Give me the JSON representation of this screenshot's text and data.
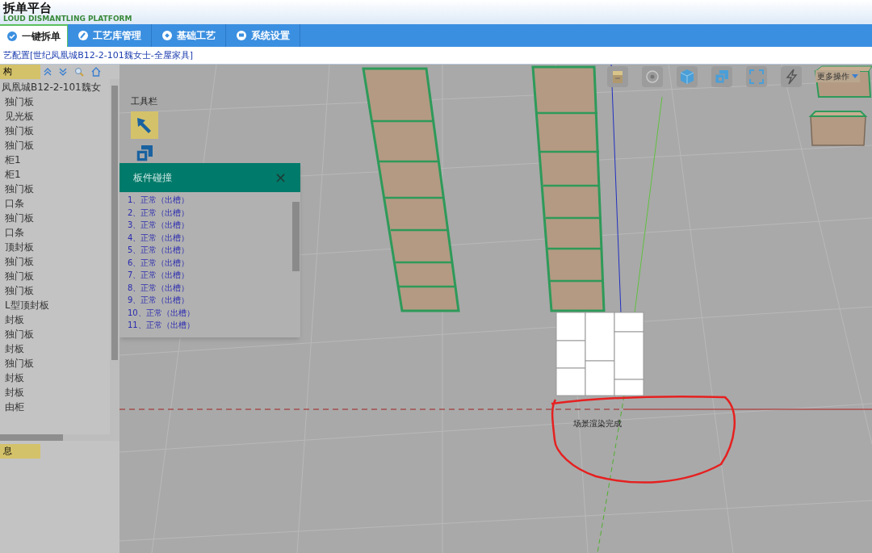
{
  "header": {
    "title": "拆单平台",
    "subtitle": "LOUD DISMANTLING PLATFORM"
  },
  "nav_tabs": [
    {
      "label": "一键拆单",
      "selected": true,
      "kind": "check"
    },
    {
      "label": "工艺库管理",
      "selected": false,
      "kind": "pen"
    },
    {
      "label": "基础工艺",
      "selected": false,
      "kind": "tag"
    },
    {
      "label": "系统设置",
      "selected": false,
      "kind": "monitor"
    }
  ],
  "breadcrumb": "艺配置[世纪凤凰城B12-2-101魏女士-全屋家具]",
  "structure_panel": {
    "title": "构",
    "tree": [
      {
        "label": "凤凰城B12-2-101魏女",
        "children": [
          {
            "label": "独门板"
          },
          {
            "label": "见光板"
          },
          {
            "label": "独门板"
          },
          {
            "label": "独门板"
          },
          {
            "label": "柜1"
          },
          {
            "label": "柜1"
          },
          {
            "label": "独门板"
          },
          {
            "label": "口条"
          },
          {
            "label": "独门板"
          },
          {
            "label": "口条"
          },
          {
            "label": "顶封板"
          },
          {
            "label": "独门板"
          },
          {
            "label": "独门板"
          },
          {
            "label": "独门板"
          },
          {
            "label": "L型顶封板"
          },
          {
            "label": "封板"
          },
          {
            "label": "独门板"
          },
          {
            "label": "封板"
          },
          {
            "label": "独门板"
          },
          {
            "label": "封板"
          },
          {
            "label": "封板"
          },
          {
            "label": "由柜"
          }
        ]
      }
    ]
  },
  "info_panel": {
    "title": "息"
  },
  "toolbar": {
    "title": "工具栏",
    "tools": [
      {
        "kind": "select",
        "selected": true
      },
      {
        "kind": "copy",
        "selected": false
      }
    ]
  },
  "view_buttons": [
    {
      "kind": "cabinet"
    },
    {
      "kind": "target"
    },
    {
      "kind": "cube3d"
    },
    {
      "kind": "copy"
    },
    {
      "kind": "fullscreen"
    },
    {
      "kind": "bolt"
    }
  ],
  "more_menu": "更多操作",
  "collision_dialog": {
    "title": "板件碰撞",
    "close": "×",
    "items": [
      "1、正常（出槽）",
      "2、正常（出槽）",
      "3、正常（出槽）",
      "4、正常（出槽）",
      "5、正常（出槽）",
      "6、正常（出槽）",
      "7、正常（出槽）",
      "8、正常（出槽）",
      "9、正常（出槽）",
      "10、正常（出槽）",
      "11、正常（出槽）"
    ]
  },
  "status": "场景渲染完成"
}
